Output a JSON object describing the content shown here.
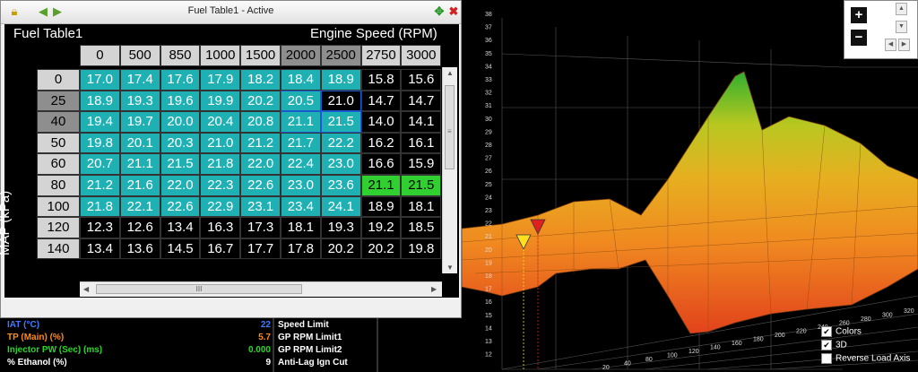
{
  "window": {
    "title": "Fuel Table1 - Active",
    "table_title": "Fuel Table1",
    "x_axis_label": "Engine Speed (RPM)",
    "y_axis_label": "MAP (kPa)"
  },
  "table": {
    "rpm": [
      "0",
      "500",
      "850",
      "1000",
      "1500",
      "2000",
      "2500",
      "2750",
      "3000"
    ],
    "map": [
      "0",
      "25",
      "40",
      "50",
      "60",
      "80",
      "100",
      "120",
      "140"
    ],
    "rows": [
      [
        "17.0",
        "17.4",
        "17.6",
        "17.9",
        "18.2",
        "18.4",
        "18.9",
        "15.8",
        "15.6"
      ],
      [
        "18.9",
        "19.3",
        "19.6",
        "19.9",
        "20.2",
        "20.5",
        "21.0",
        "14.7",
        "14.7"
      ],
      [
        "19.4",
        "19.7",
        "20.0",
        "20.4",
        "20.8",
        "21.1",
        "21.5",
        "14.0",
        "14.1"
      ],
      [
        "19.8",
        "20.1",
        "20.3",
        "21.0",
        "21.2",
        "21.7",
        "22.2",
        "16.2",
        "16.1"
      ],
      [
        "20.7",
        "21.1",
        "21.5",
        "21.8",
        "22.0",
        "22.4",
        "23.0",
        "16.6",
        "15.9"
      ],
      [
        "21.2",
        "21.6",
        "22.0",
        "22.3",
        "22.6",
        "23.0",
        "23.6",
        "21.1",
        "21.5"
      ],
      [
        "21.8",
        "22.1",
        "22.6",
        "22.9",
        "23.1",
        "23.4",
        "24.1",
        "18.9",
        "18.1"
      ],
      [
        "12.3",
        "12.6",
        "13.4",
        "16.3",
        "17.3",
        "18.1",
        "19.3",
        "19.2",
        "18.5"
      ],
      [
        "13.4",
        "13.6",
        "14.5",
        "16.7",
        "17.7",
        "17.8",
        "20.2",
        "20.2",
        "19.8"
      ]
    ]
  },
  "scrollbar": {
    "h_thumb_label": "III"
  },
  "gauges": [
    {
      "label": "IAT (°C)",
      "value": "22",
      "color": "#3f7bff"
    },
    {
      "label": "TP (Main) (%)",
      "value": "5.7",
      "color": "#ff8a1c"
    },
    {
      "label": "Injector PW (Sec) (ms)",
      "value": "0.000",
      "color": "#29d629"
    },
    {
      "label": "% Ethanol (%)",
      "value": "9",
      "color": "#ffffff"
    }
  ],
  "limits": [
    "Speed Limit",
    "GP RPM Limit1",
    "GP RPM Limit2",
    "Anti-Lag Ign Cut"
  ],
  "zoom": {
    "plus": "+",
    "minus": "−"
  },
  "checkboxes": [
    {
      "label": "Colors",
      "checked": true
    },
    {
      "label": "3D",
      "checked": true
    },
    {
      "label": "Reverse Load Axis",
      "checked": false
    }
  ],
  "axis_labels_3d": {
    "z_ticks": [
      "38",
      "37",
      "36",
      "35",
      "34",
      "33",
      "32",
      "31",
      "30",
      "29",
      "28",
      "27",
      "26",
      "25",
      "24",
      "23",
      "22",
      "21",
      "20",
      "19",
      "18",
      "17",
      "16",
      "15",
      "14",
      "13",
      "12"
    ],
    "x_ticks": [
      "20",
      "40",
      "80",
      "100",
      "120",
      "140",
      "160",
      "180",
      "200",
      "220",
      "240",
      "260",
      "280",
      "300",
      "320"
    ]
  },
  "colors": {
    "cyan": "#1fb0b4",
    "active": "#2fd02f",
    "header_light": "#d4d4d4",
    "header_dark": "#8e8e8e"
  }
}
